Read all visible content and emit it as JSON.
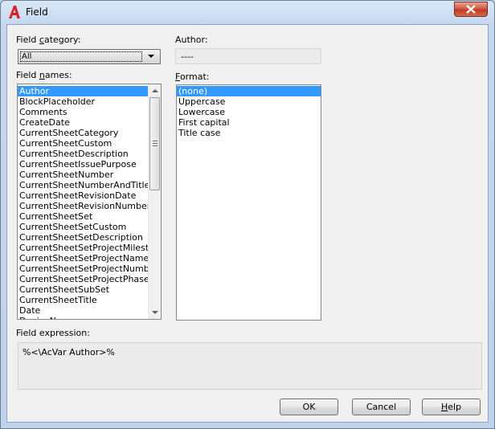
{
  "window": {
    "title": "Field",
    "close_symbol": "✕"
  },
  "field_category": {
    "label_before": "Field ",
    "label_accel": "c",
    "label_after": "ategory:",
    "value": "All"
  },
  "author": {
    "label": "Author:",
    "value": "----"
  },
  "field_names": {
    "label_before": "Field ",
    "label_accel": "n",
    "label_after": "ames:",
    "items": [
      "Author",
      "BlockPlaceholder",
      "Comments",
      "CreateDate",
      "CurrentSheetCategory",
      "CurrentSheetCustom",
      "CurrentSheetDescription",
      "CurrentSheetIssuePurpose",
      "CurrentSheetNumber",
      "CurrentSheetNumberAndTitle",
      "CurrentSheetRevisionDate",
      "CurrentSheetRevisionNumber",
      "CurrentSheetSet",
      "CurrentSheetSetCustom",
      "CurrentSheetSetDescription",
      "CurrentSheetSetProjectMilestone",
      "CurrentSheetSetProjectName",
      "CurrentSheetSetProjectNumber",
      "CurrentSheetSetProjectPhase",
      "CurrentSheetSubSet",
      "CurrentSheetTitle",
      "Date",
      "DeviceName"
    ],
    "selected": "Author"
  },
  "format": {
    "label_accel": "F",
    "label_after": "ormat:",
    "items": [
      "(none)",
      "Uppercase",
      "Lowercase",
      "First capital",
      "Title case"
    ],
    "selected": "(none)"
  },
  "field_expression": {
    "label": "Field expression:",
    "value": "%<\\AcVar Author>%"
  },
  "buttons": {
    "ok": "OK",
    "cancel": "Cancel",
    "help_accel": "H",
    "help_after": "elp"
  },
  "colors": {
    "selection": "#3399ff",
    "close_button": "#c43a23",
    "app_icon": "#d6242a"
  },
  "icons": {
    "app": "autocad-icon",
    "close": "close-icon"
  }
}
